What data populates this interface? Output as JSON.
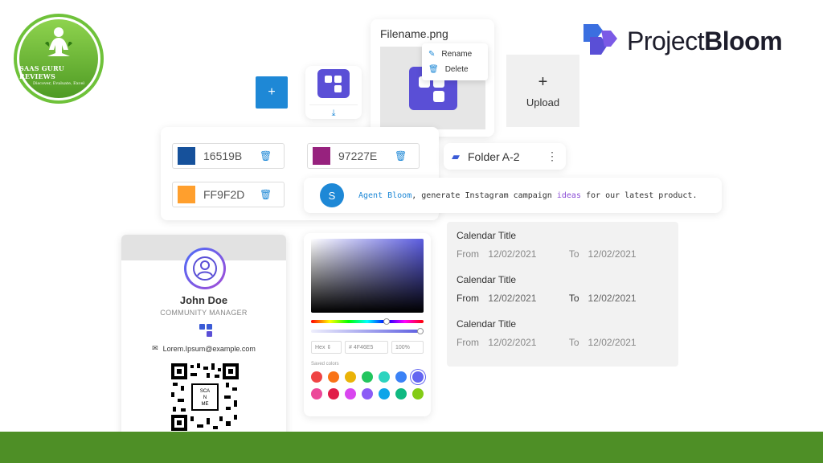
{
  "badge": {
    "title": "SAAS GURU REVIEWS",
    "subtitle": "Discover, Evaluate, Excel"
  },
  "brand": {
    "name_light": "Project",
    "name_bold": "Bloom"
  },
  "add_button": {
    "label": "+"
  },
  "file": {
    "name": "Filename.png",
    "menu": [
      {
        "label": "Rename",
        "icon": "pencil-icon"
      },
      {
        "label": "Delete",
        "icon": "trash-icon"
      }
    ]
  },
  "upload": {
    "plus": "+",
    "label": "Upload"
  },
  "colors": [
    {
      "hex": "16519B",
      "color": "#16519B"
    },
    {
      "hex": "97227E",
      "color": "#97227E"
    },
    {
      "hex": "FF9F2D",
      "color": "#FF9F2D"
    }
  ],
  "folder": {
    "name": "Folder A-2"
  },
  "agent": {
    "avatar": "S",
    "mention": "Agent Bloom",
    "part1": ", generate Instagram campaign ",
    "keyword": "ideas",
    "part2": " for our latest product."
  },
  "profile": {
    "name": "John Doe",
    "role": "COMMUNITY MANAGER",
    "email": "Lorem.Ipsum@example.com",
    "qr_text": "SCA N ME"
  },
  "picker": {
    "format": "Hex",
    "hex_value": "# 4F46E5",
    "opacity": "100%",
    "saved_label": "Saved colors",
    "saved_colors": [
      "#ef4444",
      "#f97316",
      "#eab308",
      "#22c55e",
      "#2dd4bf",
      "#3b82f6",
      "#6366f1",
      "#ec4899",
      "#e11d48",
      "#d946ef",
      "#8b5cf6",
      "#0ea5e9",
      "#10b981",
      "#84cc16"
    ]
  },
  "calendars": [
    {
      "title": "Calendar Title",
      "from_label": "From",
      "from": "12/02/2021",
      "to_label": "To",
      "to": "12/02/2021"
    },
    {
      "title": "Calendar Title",
      "from_label": "From",
      "from": "12/02/2021",
      "to_label": "To",
      "to": "12/02/2021"
    },
    {
      "title": "Calendar Title",
      "from_label": "From",
      "from": "12/02/2021",
      "to_label": "To",
      "to": "12/02/2021"
    }
  ],
  "accent": "#1e88d6",
  "footer_color": "#4e8f26"
}
